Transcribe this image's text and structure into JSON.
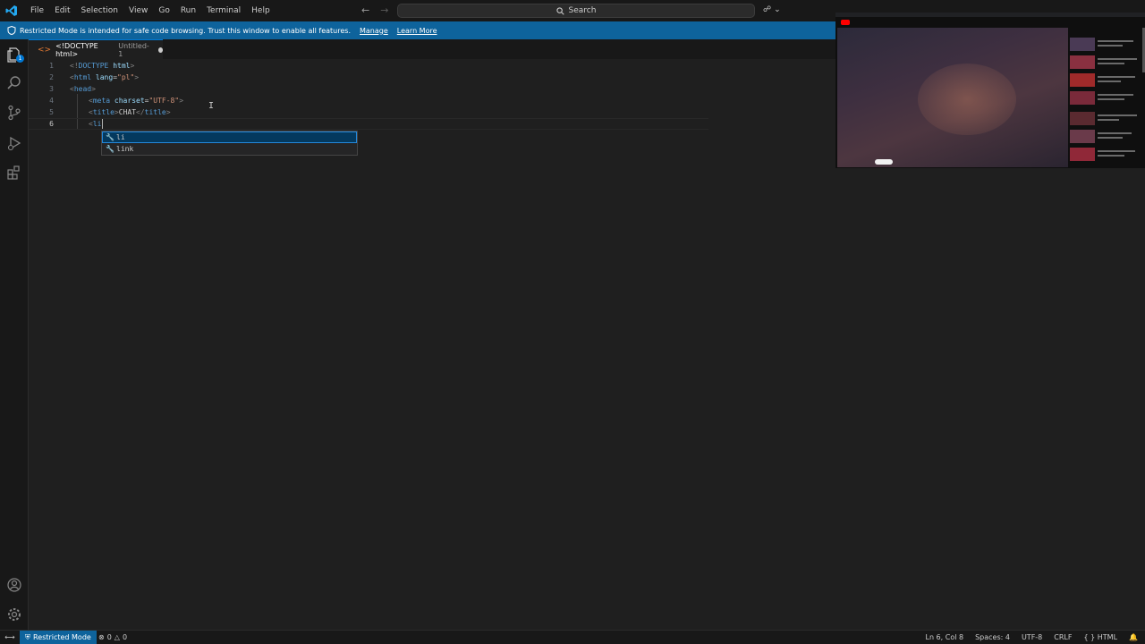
{
  "menu": [
    "File",
    "Edit",
    "Selection",
    "View",
    "Go",
    "Run",
    "Terminal",
    "Help"
  ],
  "search": {
    "label": "Search"
  },
  "banner": {
    "message": "Restricted Mode is intended for safe code browsing. Trust this window to enable all features.",
    "manage_link": "Manage",
    "learn_more_link": "Learn More"
  },
  "tab": {
    "title": "<!DOCTYPE html>",
    "subtitle": "Untitled-1"
  },
  "activity_bar": {
    "explorer_badge": "1"
  },
  "editor": {
    "line_numbers": [
      "1",
      "2",
      "3",
      "4",
      "5",
      "6"
    ],
    "active_line": 6,
    "lines": [
      "<!DOCTYPE html>",
      "<html lang=\"pl\">",
      "<head>",
      "<meta charset=\"UTF-8\">",
      "<title>CHAT</title>",
      "<li"
    ]
  },
  "suggestions": [
    {
      "label": "li",
      "selected": true
    },
    {
      "label": "link",
      "selected": false
    }
  ],
  "overlay": {
    "channel_logo": "YouTube"
  },
  "statusbar": {
    "restricted": "Restricted Mode",
    "errors": "0",
    "warnings": "0",
    "position": "Ln 6, Col 8",
    "spaces": "Spaces: 4",
    "encoding": "UTF-8",
    "eol": "CRLF",
    "language": "HTML"
  },
  "colors": {
    "accent": "#0078d4",
    "banner": "#0e639c",
    "editor_bg": "#1f1f1f",
    "tag_name": "#569cd6",
    "attribute": "#9cdcfe",
    "string": "#ce9178"
  }
}
